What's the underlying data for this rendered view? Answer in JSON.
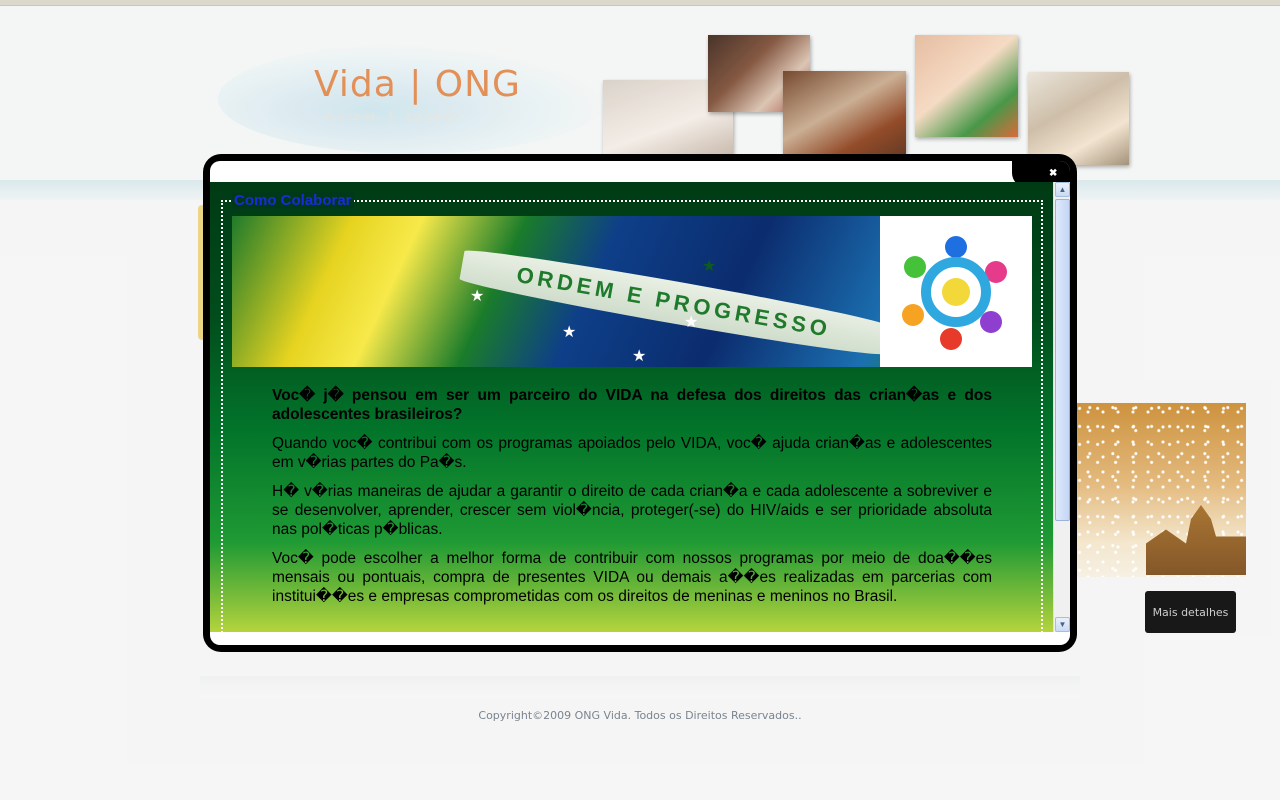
{
  "header": {
    "logo_text": "Vida | ONG",
    "logo_reflection": "Vida | ONG"
  },
  "sidebar_right": {
    "more_button_label": "Mais detalhes"
  },
  "footer": {
    "copyright": "Copyright©2009 ONG Vida. Todos os Direitos Reservados.."
  },
  "modal": {
    "close_glyph": "✖",
    "section_title": "Como Colaborar",
    "banner_motto": "ORDEM E PROGRESSO",
    "paragraphs": [
      "Voc� j� pensou em ser um parceiro do VIDA na defesa dos direitos das crian�as e dos adolescentes brasileiros?",
      "Quando voc� contribui com os programas apoiados pelo VIDA, voc� ajuda crian�as e adolescentes em v�rias partes do Pa�s.",
      "H� v�rias maneiras de ajudar a garantir o direito de cada crian�a e cada adolescente a sobreviver e se desenvolver, aprender, crescer sem viol�ncia, proteger(-se) do HIV/aids e ser prioridade absoluta nas pol�ticas p�blicas.",
      "Voc� pode escolher a melhor forma de contribuir com nossos programas por meio de doa��es mensais ou pontuais, compra de presentes VIDA ou demais a��es realizadas em parcerias com institui��es e empresas comprometidas com os direitos de meninas e meninos no Brasil."
    ]
  },
  "scrollbar": {
    "up_glyph": "▲",
    "down_glyph": "▼"
  },
  "colors": {
    "modal_frame": "#000000",
    "content_green_dark": "#003a14",
    "content_green_light": "#b5d43d",
    "section_title": "#1b2bd8",
    "logo_orange": "#e0874a"
  },
  "icons": {
    "close": "close-icon",
    "scroll_up": "chevron-up-icon",
    "scroll_down": "chevron-down-icon"
  }
}
